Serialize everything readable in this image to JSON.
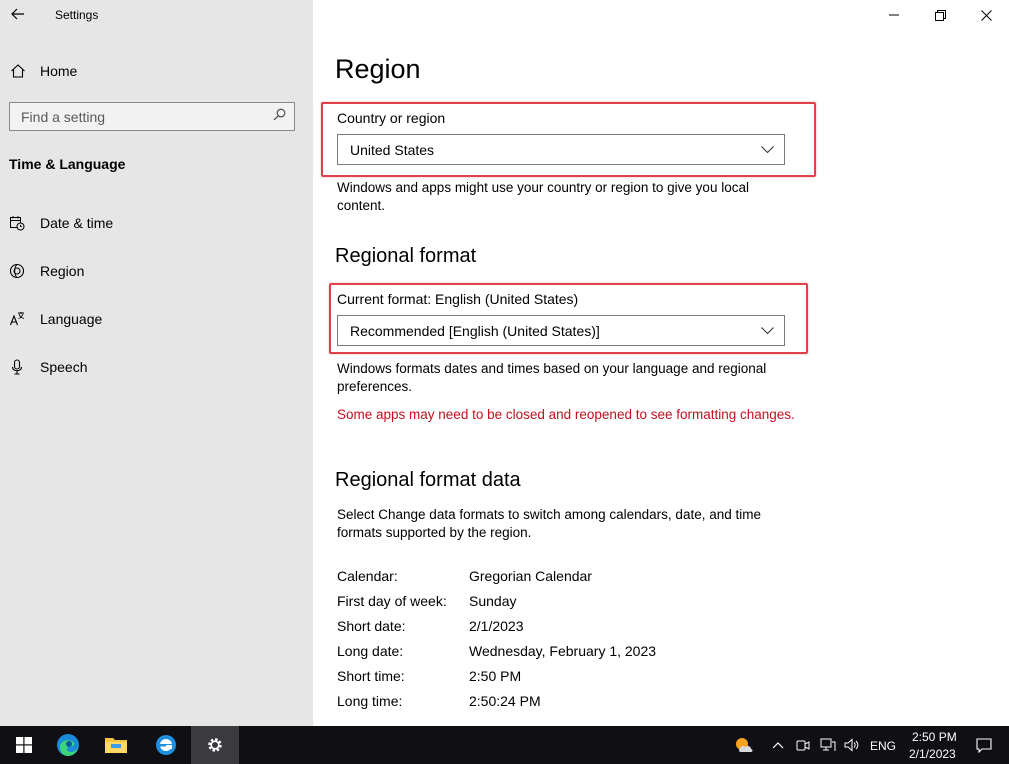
{
  "window": {
    "title": "Settings",
    "minimize_icon": "minimize-icon",
    "maximize_icon": "restore-icon",
    "close_icon": "close-icon"
  },
  "sidebar": {
    "home_label": "Home",
    "search_placeholder": "Find a setting",
    "section_title": "Time & Language",
    "items": [
      {
        "label": "Date & time",
        "icon": "calendar-clock-icon"
      },
      {
        "label": "Region",
        "icon": "globe-icon"
      },
      {
        "label": "Language",
        "icon": "language-icon"
      },
      {
        "label": "Speech",
        "icon": "microphone-icon"
      }
    ]
  },
  "main": {
    "title": "Region",
    "country": {
      "label": "Country or region",
      "value": "United States",
      "description": "Windows and apps might use your country or region to give you local content."
    },
    "regional_format": {
      "heading": "Regional format",
      "current_label": "Current format: English (United States)",
      "value": "Recommended [English (United States)]",
      "description": "Windows formats dates and times based on your language and regional preferences.",
      "warning": "Some apps may need to be closed and reopened to see formatting changes."
    },
    "format_data": {
      "heading": "Regional format data",
      "description": "Select Change data formats to switch among calendars, date, and time formats supported by the region.",
      "rows": [
        {
          "key": "Calendar:",
          "value": "Gregorian Calendar"
        },
        {
          "key": "First day of week:",
          "value": "Sunday"
        },
        {
          "key": "Short date:",
          "value": "2/1/2023"
        },
        {
          "key": "Long date:",
          "value": "Wednesday, February 1, 2023"
        },
        {
          "key": "Short time:",
          "value": "2:50 PM"
        },
        {
          "key": "Long time:",
          "value": "2:50:24 PM"
        }
      ]
    }
  },
  "taskbar": {
    "language": "ENG",
    "time": "2:50 PM",
    "date": "2/1/2023"
  },
  "colors": {
    "highlight": "#e0404a",
    "warning": "#c50f1f",
    "sidebar_bg": "#e6e6e6",
    "taskbar_bg": "#0f0f14"
  }
}
